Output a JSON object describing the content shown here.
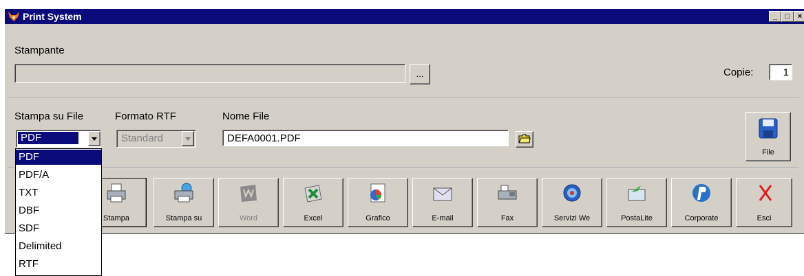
{
  "window": {
    "title": "Print System",
    "controls": [
      "_",
      "□",
      "×"
    ]
  },
  "printer": {
    "label": "Stampante",
    "value": "",
    "browse_label": "..."
  },
  "copies": {
    "label": "Copie:",
    "value": "1"
  },
  "print_to_file": {
    "label": "Stampa su File",
    "selected": "PDF"
  },
  "rtf_format": {
    "label": "Formato RTF",
    "selected": "Standard"
  },
  "file_name": {
    "label": "Nome File",
    "value": "DEFA0001.PDF"
  },
  "file_button": {
    "label": "File"
  },
  "toolbar": [
    {
      "label": "Stampa",
      "icon": "printer-icon"
    },
    {
      "label": "Stampa su",
      "icon": "print-to-icon"
    },
    {
      "label": "Word",
      "icon": "word-icon"
    },
    {
      "label": "Excel",
      "icon": "excel-icon"
    },
    {
      "label": "Grafico",
      "icon": "chart-icon"
    },
    {
      "label": "E-mail",
      "icon": "email-icon"
    },
    {
      "label": "Fax",
      "icon": "fax-icon"
    },
    {
      "label": "Servizi We",
      "icon": "web-services-icon"
    },
    {
      "label": "PostaLite",
      "icon": "postalite-icon"
    },
    {
      "label": "Corporate",
      "icon": "corporate-icon"
    },
    {
      "label": "Esci",
      "icon": "exit-icon"
    }
  ],
  "file_type_options": [
    "PDF",
    "PDF/A",
    "TXT",
    "DBF",
    "SDF",
    "Delimited",
    "RTF"
  ],
  "colors": {
    "title_bar": "#0a0a7a",
    "face": "#d4d0c8",
    "selection": "#0a0a7a"
  }
}
